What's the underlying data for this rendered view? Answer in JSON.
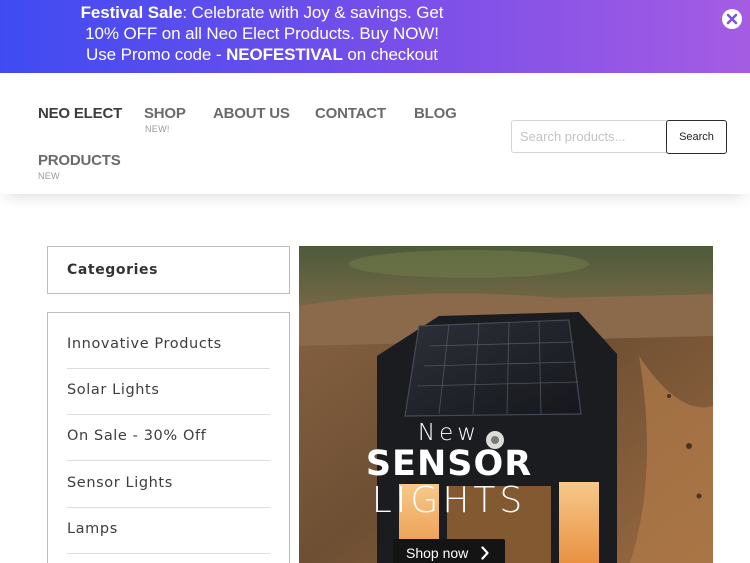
{
  "promo": {
    "sale_label": "Festival Sale",
    "line1_rest": ": Celebrate with Joy & savings. Get",
    "line2": "10% OFF on all Neo Elect Products. Buy NOW!",
    "line3_prefix": "Use Promo code - ",
    "code": "NEOFESTIVAL",
    "line3_suffix": " on checkout",
    "close_icon": "close-circle-icon"
  },
  "nav": {
    "brand": "NEO ELECT",
    "shop": "SHOP",
    "shop_badge": "NEW!",
    "about": "ABOUT US",
    "contact": "CONTACT",
    "blog": "BLOG",
    "products": "PRODUCTS",
    "products_badge": "NEW"
  },
  "search": {
    "placeholder": "Search products...",
    "button_label": "Search"
  },
  "sidebar": {
    "title": "Categories",
    "items": [
      {
        "label": "Innovative Products"
      },
      {
        "label": "Solar Lights"
      },
      {
        "label": "On Sale - 30% Off"
      },
      {
        "label": "Sensor Lights"
      },
      {
        "label": "Lamps"
      }
    ]
  },
  "hero": {
    "line1": "New",
    "line2": "SENSOR",
    "line3": "LIGHTS",
    "cta_label": "Shop now",
    "cta_icon": "chevron-right-icon"
  },
  "colors": {
    "banner_start": "#3f4bf2",
    "banner_end": "#a55ce3",
    "cta_bg": "#141414"
  }
}
